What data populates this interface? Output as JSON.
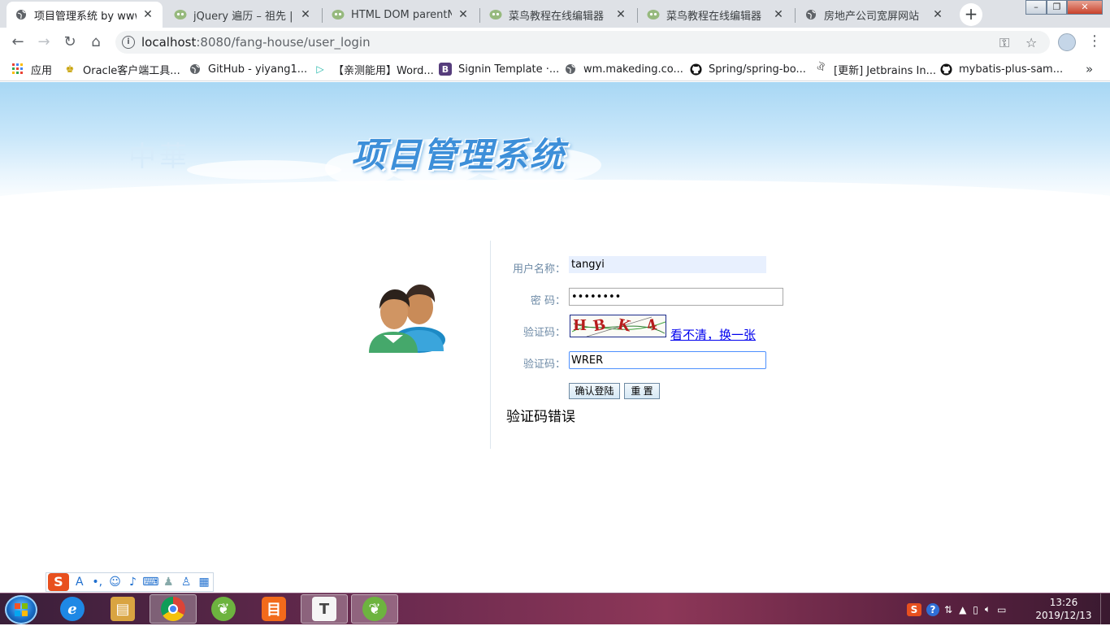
{
  "browser": {
    "tabs": [
      {
        "title": "项目管理系统 by www.r",
        "icon": "globe-icon",
        "active": true
      },
      {
        "title": "jQuery 遍历 – 祖先 | 菜",
        "icon": "runoob-icon",
        "active": false
      },
      {
        "title": "HTML DOM parentNo",
        "icon": "runoob-icon",
        "active": false
      },
      {
        "title": "菜鸟教程在线编辑器",
        "icon": "runoob-icon",
        "active": false
      },
      {
        "title": "菜鸟教程在线编辑器",
        "icon": "runoob-icon",
        "active": false
      },
      {
        "title": "房地产公司宽屏网站",
        "icon": "globe-icon",
        "active": false
      }
    ],
    "address": {
      "host": "localhost",
      "path": ":8080/fang-house/user_login"
    },
    "bookmarks": [
      {
        "label": "应用",
        "icon": "apps-grid-icon"
      },
      {
        "label": "Oracle客户端工具...",
        "icon": "oracle-icon"
      },
      {
        "label": "GitHub - yiyang1...",
        "icon": "globe-icon"
      },
      {
        "label": "【亲测能用】Word...",
        "icon": "play-icon"
      },
      {
        "label": "Signin Template ·...",
        "icon": "bootstrap-icon"
      },
      {
        "label": "wm.makeding.co...",
        "icon": "globe-icon"
      },
      {
        "label": "Spring/spring-bo...",
        "icon": "github-icon"
      },
      {
        "label": "[更新] Jetbrains In...",
        "icon": "jetbrains-icon"
      },
      {
        "label": "mybatis-plus-sam...",
        "icon": "github-icon"
      }
    ],
    "bookmarks_more": "»"
  },
  "page": {
    "banner_title": "项目管理系统",
    "banner_watermark": "中華",
    "login": {
      "username_label": "用户名称：",
      "username_value": "tangyi",
      "password_label": "密 码：",
      "password_value": "••••••••",
      "captcha_label": "验证码：",
      "captcha_chars": [
        "H",
        "B",
        "K",
        "4"
      ],
      "captcha_refresh": "看不清，换一张",
      "captcha_input_label": "验证码：",
      "captcha_input_value": "WRER",
      "login_button": "确认登陆",
      "reset_button": "重 置",
      "error_message": "验证码错误"
    }
  },
  "taskbar": {
    "apps": [
      {
        "name": "ie",
        "icon": "ie-icon",
        "glyph": "e",
        "color": "#1e88e5"
      },
      {
        "name": "explorer",
        "icon": "folder-icon",
        "glyph": "▤",
        "color": "#d9a441"
      },
      {
        "name": "chrome",
        "icon": "chrome-icon",
        "glyph": "●",
        "color": "#e04a3a",
        "active": true
      },
      {
        "name": "spring-tool",
        "icon": "spring-leaf-icon",
        "glyph": "❦",
        "color": "#6db33f"
      },
      {
        "name": "app-orange",
        "icon": "orange-app-icon",
        "glyph": "目",
        "color": "#f26a1b"
      },
      {
        "name": "typora",
        "icon": "typora-icon",
        "glyph": "T",
        "color": "#555555"
      },
      {
        "name": "spring-tool-2",
        "icon": "spring-leaf-icon",
        "glyph": "❦",
        "color": "#6db33f",
        "active": true
      }
    ],
    "clock_time": "13:26",
    "clock_date": "2019/12/13"
  },
  "colors": {
    "banner_top": "#a8d7f4",
    "label": "#6d8aa6",
    "link": "#0000ee",
    "captcha_text": "#b71c1c"
  }
}
